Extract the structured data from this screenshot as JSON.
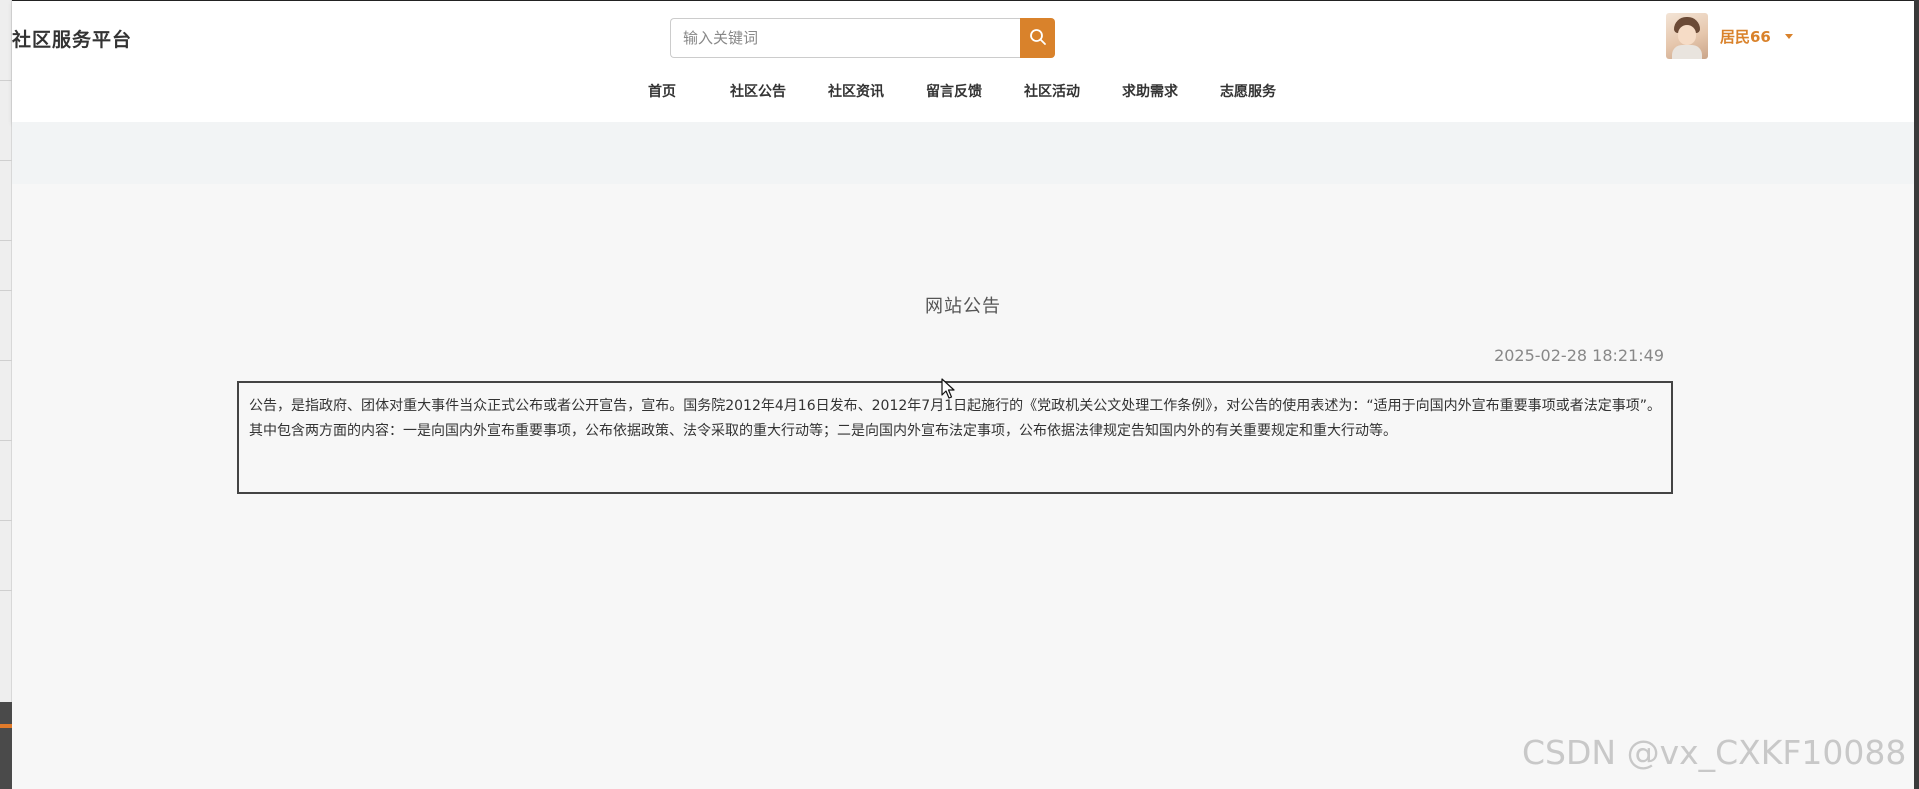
{
  "header": {
    "site_title": "社区服务平台",
    "search": {
      "placeholder": "输入关键词",
      "value": ""
    },
    "user": {
      "name": "居民66"
    }
  },
  "nav": {
    "items": [
      {
        "label": "首页"
      },
      {
        "label": "社区公告"
      },
      {
        "label": "社区资讯"
      },
      {
        "label": "留言反馈"
      },
      {
        "label": "社区活动"
      },
      {
        "label": "求助需求"
      },
      {
        "label": "志愿服务"
      }
    ]
  },
  "notice": {
    "title": "网站公告",
    "time": "2025-02-28 18:21:49",
    "content": "公告，是指政府、团体对重大事件当众正式公布或者公开宣告，宣布。国务院2012年4月16日发布、2012年7月1日起施行的《党政机关公文处理工作条例》，对公告的使用表述为：“适用于向国内外宣布重要事项或者法定事项”。其中包含两方面的内容：一是向国内外宣布重要事项，公布依据政策、法令采取的重大行动等；二是向国内外宣布法定事项，公布依据法律规定告知国内外的有关重要规定和重大行动等。"
  },
  "watermark": "CSDN @vx_CXKF10088",
  "colors": {
    "accent": "#d9822b",
    "page_background": "#f7f7f7",
    "header_background": "#ffffff"
  },
  "icons": {
    "search": "search-icon",
    "caret": "caret-down-icon",
    "cursor": "mouse-pointer-icon"
  }
}
